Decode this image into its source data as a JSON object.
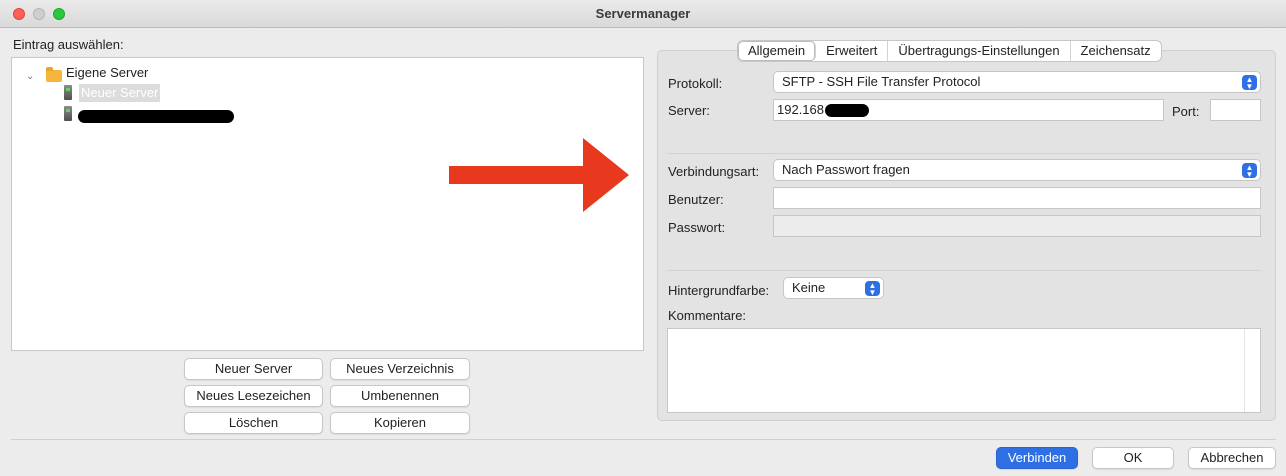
{
  "window": {
    "title": "Servermanager"
  },
  "left": {
    "label": "Eintrag auswählen:",
    "tree": {
      "root": "Eigene Server",
      "items": [
        {
          "label": "Neuer Server",
          "selected": true
        },
        {
          "label": "",
          "redacted": true
        }
      ]
    },
    "buttons": {
      "new_server": "Neuer Server",
      "new_folder": "Neues Verzeichnis",
      "new_bookmark": "Neues Lesezeichen",
      "rename": "Umbenennen",
      "delete": "Löschen",
      "copy": "Kopieren"
    }
  },
  "tabs": [
    "Allgemein",
    "Erweitert",
    "Übertragungs-Einstellungen",
    "Zeichensatz"
  ],
  "form": {
    "protocol_label": "Protokoll:",
    "protocol_value": "SFTP - SSH File Transfer Protocol",
    "server_label": "Server:",
    "server_value": "192.168",
    "port_label": "Port:",
    "port_value": "",
    "conn_label": "Verbindungsart:",
    "conn_value": "Nach Passwort fragen",
    "user_label": "Benutzer:",
    "user_value": "",
    "pass_label": "Passwort:",
    "pass_value": "",
    "bg_label": "Hintergrundfarbe:",
    "bg_value": "Keine",
    "comments_label": "Kommentare:"
  },
  "footer": {
    "connect": "Verbinden",
    "ok": "OK",
    "cancel": "Abbrechen"
  },
  "colors": {
    "arrow": "#e8381e",
    "primary": "#2f6fe4"
  }
}
